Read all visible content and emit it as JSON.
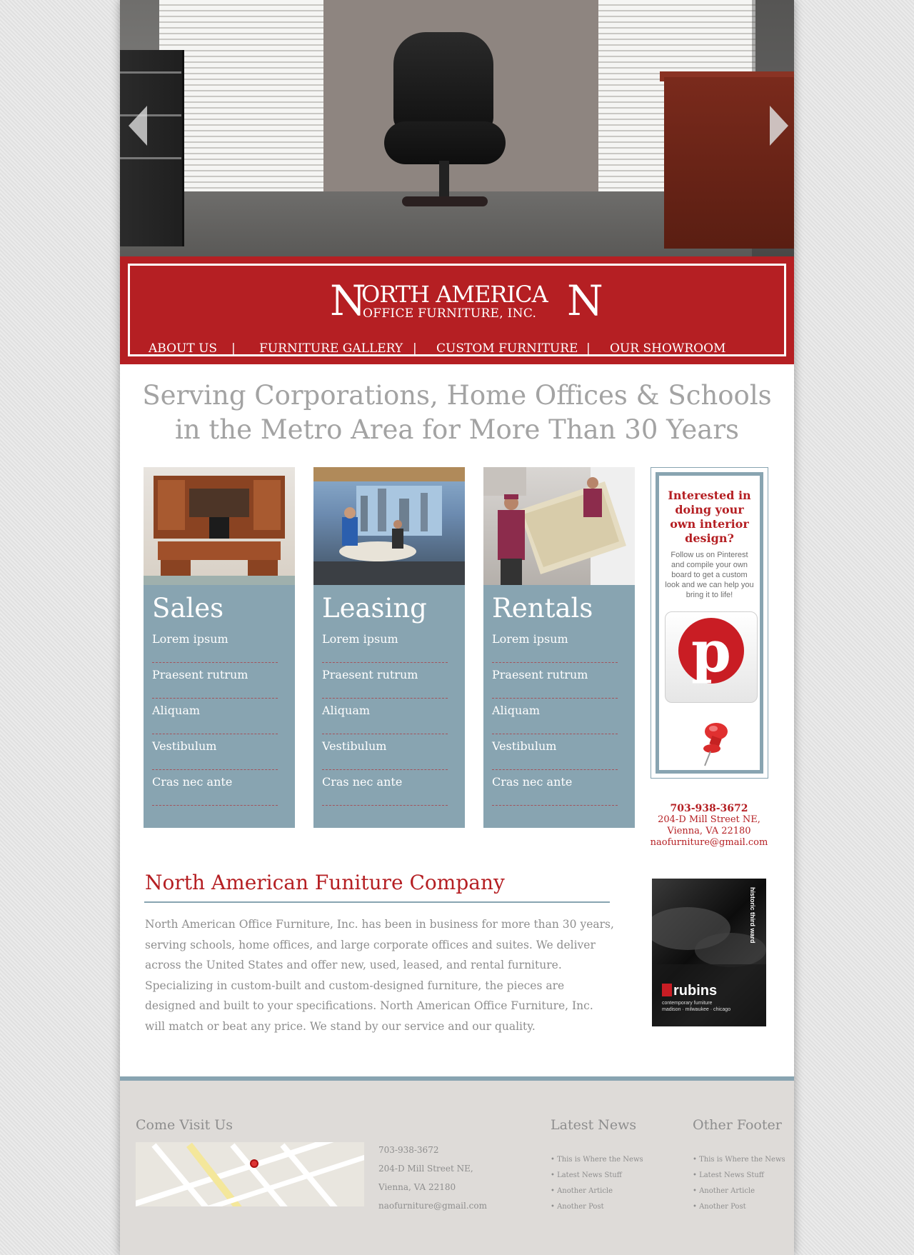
{
  "hero": {
    "prev_label": "",
    "next_label": ""
  },
  "brand": {
    "logo_left_n": "N",
    "logo_line1": "ORTH AMERICA",
    "logo_right_n": "N",
    "logo_line2": "OFFICE FURNITURE, INC."
  },
  "nav": {
    "items": [
      "ABOUT US",
      "FURNITURE GALLERY",
      "CUSTOM FURNITURE",
      "OUR SHOWROOM"
    ],
    "separator": "|"
  },
  "tagline": {
    "line1": "Serving Corporations, Home Offices & Schools",
    "line2": "in the Metro Area for More Than 30 Years"
  },
  "services": [
    {
      "title": "Sales",
      "items": [
        "Lorem ipsum",
        "Praesent rutrum",
        "Aliquam",
        "Vestibulum",
        "Cras nec ante"
      ]
    },
    {
      "title": "Leasing",
      "items": [
        "Lorem ipsum",
        "Praesent rutrum",
        "Aliquam",
        "Vestibulum",
        "Cras nec ante"
      ]
    },
    {
      "title": "Rentals",
      "items": [
        "Lorem ipsum",
        "Praesent rutrum",
        "Aliquam",
        "Vestibulum",
        "Cras nec ante"
      ]
    }
  ],
  "pinterest": {
    "title": "Interested in doing your own interior design?",
    "text": "Follow us on Pinterest and compile your own board to get a custom look and we can help you bring it to life!",
    "logo_letter": "p"
  },
  "contact": {
    "phone": "703-938-3672",
    "street": "204-D Mill Street NE,",
    "city": "Vienna, VA 22180",
    "email": "naofurniture@gmail.com"
  },
  "about": {
    "title": "North American Funiture Company",
    "body": "North American Office Furniture, Inc. has been in business for more than 30 years, serving schools, home offices, and large corporate offices and suites. We deliver across the United States and offer new, used, leased, and rental furniture. Specializing in custom-built and custom-designed furniture, the pieces are designed and built to your specifications. North American Office Furniture, Inc. will match or beat any price. We stand by our service and our quality."
  },
  "ad": {
    "brand": "rubins",
    "sub1": "contemporary furniture",
    "sub2": "madison · milwaukee · chicago",
    "side": "historic third ward"
  },
  "footer": {
    "visit_title": "Come Visit Us",
    "phone": "703-938-3672",
    "street": "204-D Mill Street NE,",
    "city": "Vienna, VA 22180",
    "email": "naofurniture@gmail.com",
    "news_title": "Latest News",
    "news_items": [
      "This is Where the News",
      "Latest News Stuff",
      "Another Article",
      "Another Post"
    ],
    "other_title": "Other Footer",
    "other_items": [
      "This is Where the News",
      "Latest News Stuff",
      "Another Article",
      "Another Post"
    ]
  },
  "colors": {
    "brand_red": "#b51f23",
    "steel_blue": "#88a4b1",
    "text_gray": "#8e8e8e",
    "footer_bg": "#dedbd8"
  }
}
